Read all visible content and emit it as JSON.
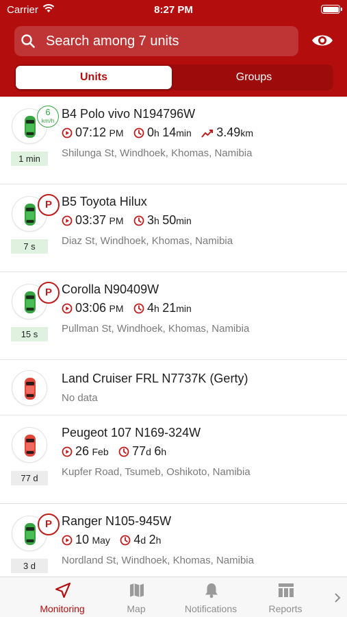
{
  "status_bar": {
    "carrier": "Carrier",
    "time": "8:27 PM"
  },
  "search": {
    "placeholder": "Search among 7 units"
  },
  "segments": {
    "units": "Units",
    "groups": "Groups"
  },
  "colors": {
    "brand": "#b30d0d",
    "moving": "#35a340",
    "parked": "#c01b1b"
  },
  "units": [
    {
      "name": "B4 Polo vivo N194796W",
      "status": "moving",
      "speed": "6",
      "speed_unit": "km/h",
      "age": "1 min",
      "time": "07:12",
      "ampm": "PM",
      "dur_h": "0",
      "dur_h_unit": "h",
      "dur_m": "14",
      "dur_m_unit": "min",
      "dist": "3.49",
      "dist_unit": "km",
      "address": "Shilunga St, Windhoek, Khomas, Namibia"
    },
    {
      "name": "B5 Toyota Hilux",
      "status": "parked",
      "badge": "P",
      "age": "7 s",
      "time": "03:37",
      "ampm": "PM",
      "dur_h": "3",
      "dur_h_unit": "h",
      "dur_m": "50",
      "dur_m_unit": "min",
      "address": "Diaz St, Windhoek, Khomas, Namibia"
    },
    {
      "name": "Corolla N90409W",
      "status": "parked",
      "badge": "P",
      "age": "15 s",
      "time": "03:06",
      "ampm": "PM",
      "dur_h": "4",
      "dur_h_unit": "h",
      "dur_m": "21",
      "dur_m_unit": "min",
      "address": "Pullman St, Windhoek, Khomas, Namibia"
    },
    {
      "name": "Land Cruiser FRL N7737K (Gerty)",
      "status": "no-data",
      "address": "No data"
    },
    {
      "name": "Peugeot 107 N169-324W",
      "status": "offline",
      "age": "77 d",
      "time": "26",
      "ampm": "Feb",
      "dur_h": "77",
      "dur_h_unit": "d",
      "dur_m": "6",
      "dur_m_unit": "h",
      "address": "Kupfer Road, Tsumeb, Oshikoto, Namibia"
    },
    {
      "name": "Ranger N105-945W",
      "status": "parked",
      "badge": "P",
      "age": "3 d",
      "time": "10",
      "ampm": "May",
      "dur_h": "4",
      "dur_h_unit": "d",
      "dur_m": "2",
      "dur_m_unit": "h",
      "address": "Nordland St, Windhoek, Khomas, Namibia"
    }
  ],
  "tabs": [
    {
      "label": "Monitoring",
      "icon": "navigation-arrow-icon",
      "active": true
    },
    {
      "label": "Map",
      "icon": "map-icon"
    },
    {
      "label": "Notifications",
      "icon": "bell-icon"
    },
    {
      "label": "Reports",
      "icon": "table-icon"
    }
  ]
}
